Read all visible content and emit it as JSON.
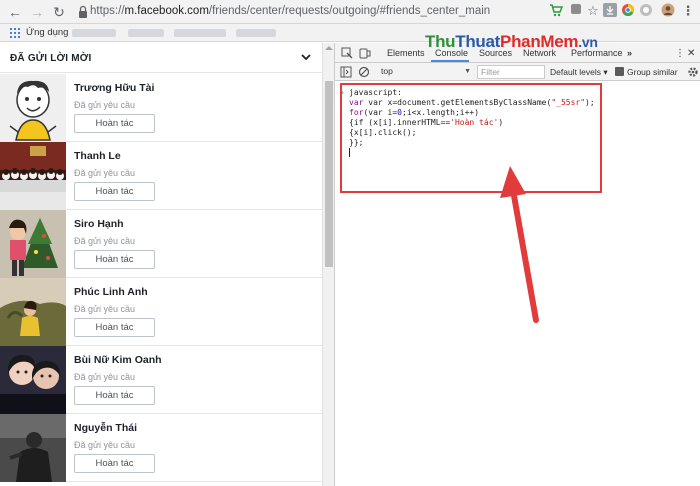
{
  "browser": {
    "url_prefix": "https://",
    "url_host": "m.facebook.com",
    "url_path": "/friends/center/requests/outgoing/#friends_center_main",
    "apps_label": "Ứng dụng"
  },
  "page": {
    "header": "ĐÃ GỬI LỜI MỜI",
    "friends": [
      {
        "name": "Trương Hữu Tài",
        "status": "Đã gửi yêu cầu",
        "button": "Hoàn tác"
      },
      {
        "name": "Thanh Le",
        "status": "Đã gửi yêu cầu",
        "button": "Hoàn tác"
      },
      {
        "name": "Siro Hạnh",
        "status": "Đã gửi yêu cầu",
        "button": "Hoàn tác"
      },
      {
        "name": "Phúc Linh Anh",
        "status": "Đã gửi yêu cầu",
        "button": "Hoàn tác"
      },
      {
        "name": "Bùi Nữ Kim Oanh",
        "status": "Đã gửi yêu cầu",
        "button": "Hoàn tác"
      },
      {
        "name": "Nguyễn Thái",
        "status": "Đã gửi yêu cầu",
        "button": "Hoàn tác"
      }
    ]
  },
  "devtools": {
    "tabs": [
      "Elements",
      "Console",
      "Sources",
      "Network",
      "Performance"
    ],
    "more_tabs": "»",
    "context": "top",
    "filter_placeholder": "Filter",
    "levels": "Default levels ▾",
    "group_similar": "Group similar",
    "prompt": "›",
    "code": {
      "l1": "javascript:",
      "l2_a": "var x=document.getElementsByClassName(",
      "l2_str": "\"_55sr\"",
      "l2_b": ");",
      "l3_kw": "for",
      "l3_a": "(var i=",
      "l3_n": "0",
      "l3_b": ";i<x.length;i++)",
      "l4_a": "{if (x[i].innerHTML==",
      "l4_str": "'Hoàn tác'",
      "l4_b": ")",
      "l5": "{x[i].click();",
      "l6": "}};"
    }
  },
  "watermark": {
    "part1": "Thu",
    "part2": "Thuat",
    "part3": "PhanMem",
    "part4": ".vn"
  },
  "colors": {
    "highlight_box": "#e23b3b",
    "devtools_accent": "#4a89dc"
  }
}
